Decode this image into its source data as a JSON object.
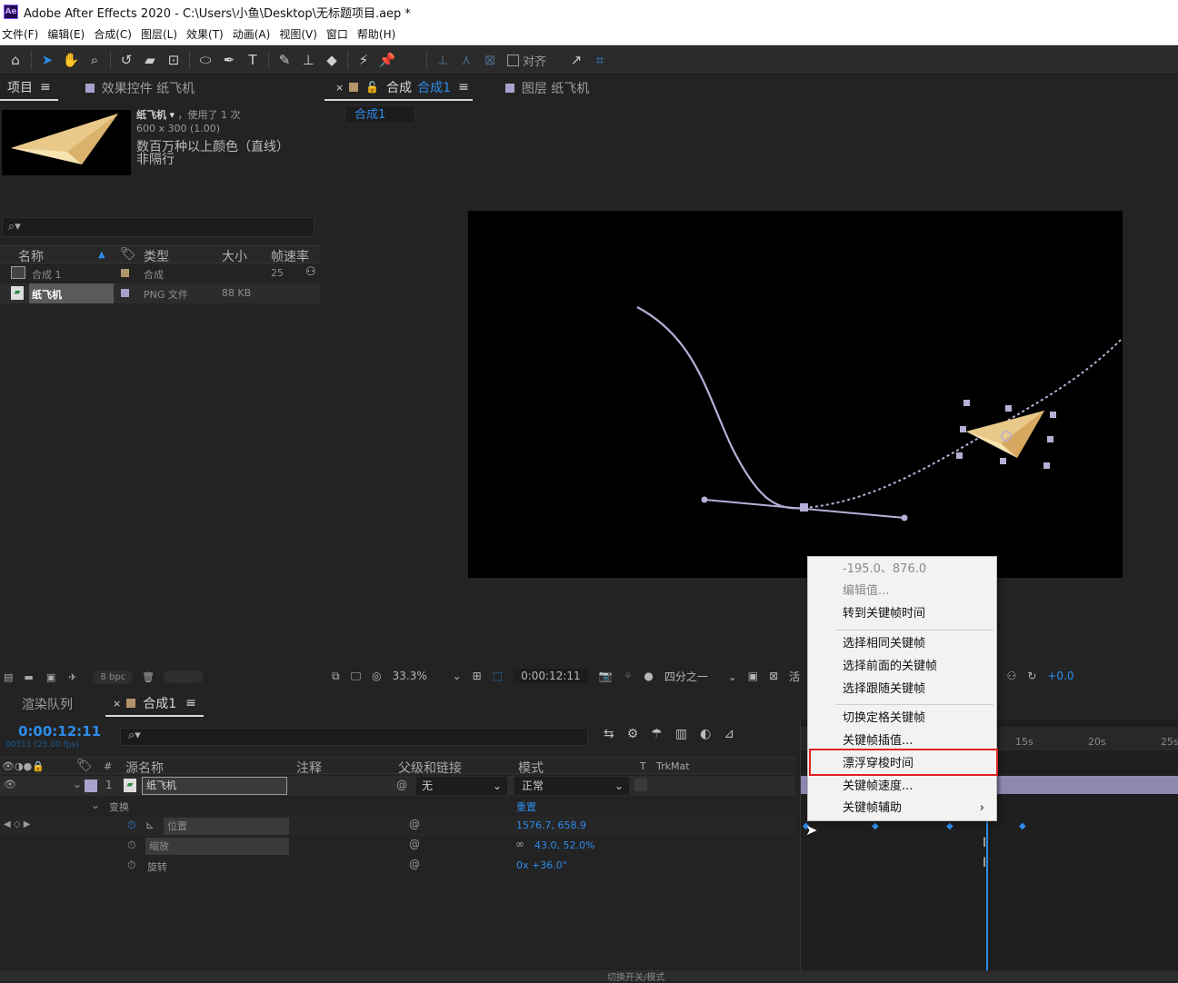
{
  "titlebar": {
    "title": "Adobe After Effects 2020 - C:\\Users\\小鱼\\Desktop\\无标题项目.aep *",
    "app_abbr": "Ae"
  },
  "menu": [
    "文件(F)",
    "编辑(E)",
    "合成(C)",
    "图层(L)",
    "效果(T)",
    "动画(A)",
    "视图(V)",
    "窗口",
    "帮助(H)"
  ],
  "toolbar": {
    "align_label": "对齐"
  },
  "project_panel": {
    "tab_project": "项目",
    "tab_effects": "效果控件 纸飞机",
    "item_name": "纸飞机",
    "usage": "，使用了 1 次",
    "dims": "600 x 300 (1.00)",
    "color_desc": "数百万种以上颜色（直线）",
    "interlace": "非隔行",
    "search_icon": "⌕▾",
    "columns": {
      "name": "名称",
      "type": "类型",
      "size": "大小",
      "fps": "帧速率"
    },
    "items": [
      {
        "name": "合成 1",
        "type": "合成",
        "size": "",
        "fps": "25",
        "swatch": "#b3946a"
      },
      {
        "name": "纸飞机",
        "type": "PNG 文件",
        "size": "88 KB",
        "fps": "",
        "swatch": "#a7a2cc"
      }
    ],
    "bpc": "8 bpc"
  },
  "viewer": {
    "tab_comp_prefix": "合成",
    "tab_comp_name": "合成1",
    "tab_layer": "图层 纸飞机",
    "sub_tab": "合成1",
    "zoom": "33.3%",
    "time": "0:00:12:11",
    "resolution": "四分之一",
    "active_prefix": "活",
    "exposure": "+0.0"
  },
  "timeline": {
    "tab_render": "渲染队列",
    "tab_comp": "合成1",
    "timecode": "0:00:12:11",
    "frames": "00311 (25.00 fps)",
    "columns": {
      "source": "源名称",
      "comment": "注释",
      "parent": "父级和链接",
      "mode": "模式",
      "trk_t": "T",
      "trkmat": "TrkMat"
    },
    "layer": {
      "num": "1",
      "name": "纸飞机",
      "parent": "无",
      "mode": "正常"
    },
    "transform_label": "变换",
    "reset": "重置",
    "props": [
      {
        "name": "位置",
        "value": "1576.7, 658.9"
      },
      {
        "name": "缩放",
        "value": "43.0, 52.0%"
      },
      {
        "name": "旋转",
        "value": "0x +36.0°"
      }
    ],
    "ruler": [
      "15s",
      "20s",
      "25s"
    ],
    "footer": "切换开关/模式"
  },
  "context_menu": {
    "items": [
      {
        "label": "-195.0、876.0",
        "disabled": true
      },
      {
        "label": "编辑值...",
        "disabled": true
      },
      {
        "label": "转到关键帧时间",
        "disabled": false
      },
      {
        "label": "选择相同关键帧",
        "disabled": false
      },
      {
        "label": "选择前面的关键帧",
        "disabled": false
      },
      {
        "label": "选择跟随关键帧",
        "disabled": false
      },
      {
        "label": "切换定格关键帧",
        "disabled": false
      },
      {
        "label": "关键帧插值...",
        "disabled": false
      },
      {
        "label": "漂浮穿梭时间",
        "disabled": false,
        "highlighted": true
      },
      {
        "label": "关键帧速度...",
        "disabled": false
      },
      {
        "label": "关键帧辅助",
        "disabled": false,
        "submenu": true
      }
    ],
    "submenu_arrow": "›"
  },
  "colors": {
    "accent": "#2d8ceb",
    "highlight_box": "#e02020",
    "comp_swatch": "#b3946a",
    "layer_swatch": "#a7a2cc",
    "motion_path": "#b4b0d6"
  }
}
